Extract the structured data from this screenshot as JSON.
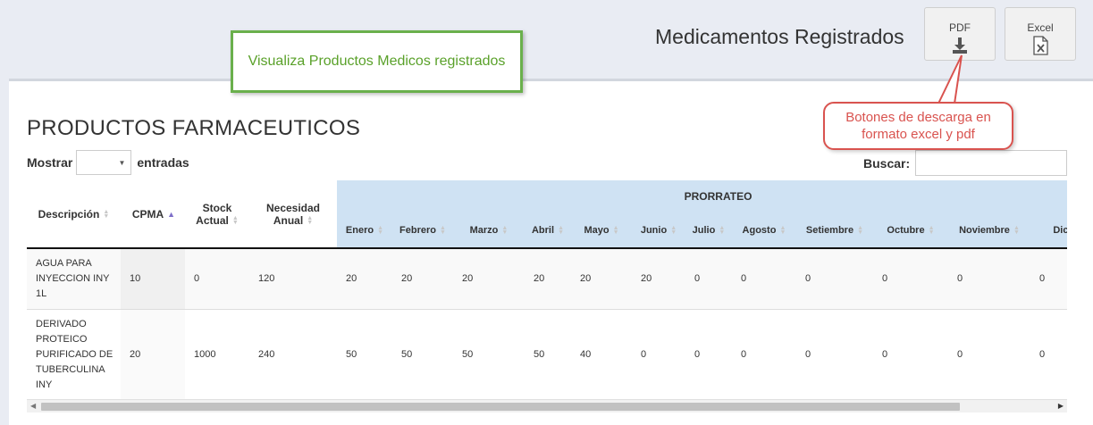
{
  "header": {
    "title": "Medicamentos Registrados",
    "pdf_label": "PDF",
    "excel_label": "Excel"
  },
  "annotations": {
    "green_note": "Visualiza Productos Medicos registrados",
    "red_note_line1": "Botones de descarga en",
    "red_note_line2": "formato excel y pdf"
  },
  "section": {
    "title": "PRODUCTOS FARMACEUTICOS"
  },
  "controls": {
    "show_label": "Mostrar",
    "entries_label": "entradas",
    "length_value": "",
    "search_label": "Buscar:",
    "search_value": ""
  },
  "table": {
    "columns": {
      "descripcion": "Descripción",
      "cpma": "CPMA",
      "stock_line1": "Stock",
      "stock_line2": "Actual",
      "necesidad_line1": "Necesidad",
      "necesidad_line2": "Anual",
      "prorrateo": "PRORRATEO"
    },
    "months": [
      "Enero",
      "Febrero",
      "Marzo",
      "Abril",
      "Mayo",
      "Junio",
      "Julio",
      "Agosto",
      "Setiembre",
      "Octubre",
      "Noviembre",
      "Dicie"
    ],
    "rows": [
      {
        "desc_lines": [
          "AGUA PARA",
          "INYECCION INY",
          "1L"
        ],
        "cpma": "10",
        "stock": "0",
        "necesidad": "120",
        "months": [
          "20",
          "20",
          "20",
          "20",
          "20",
          "20",
          "0",
          "0",
          "0",
          "0",
          "0",
          "0"
        ]
      },
      {
        "desc_lines": [
          "DERIVADO",
          "PROTEICO",
          "PURIFICADO DE",
          "TUBERCULINA",
          "INY"
        ],
        "cpma": "20",
        "stock": "1000",
        "necesidad": "240",
        "months": [
          "50",
          "50",
          "50",
          "50",
          "40",
          "0",
          "0",
          "0",
          "0",
          "0",
          "0",
          "0"
        ]
      }
    ]
  },
  "colors": {
    "annotation_green": "#6ab04c",
    "annotation_red": "#d9534f",
    "prorrateo_header": "#cfe2f3",
    "sort_active": "#7e6fc9"
  },
  "icons": {
    "pdf": "download-icon",
    "excel": "excel-file-icon"
  }
}
